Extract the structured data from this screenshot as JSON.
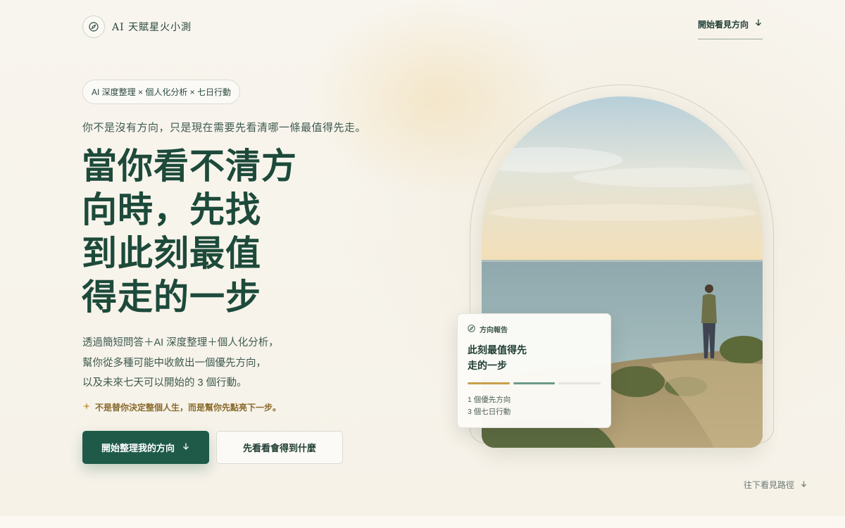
{
  "header": {
    "brand_name": "AI 天賦星火小測",
    "nav_link": "開始看見方向"
  },
  "hero": {
    "tag_pill": "AI 深度整理 × 個人化分析 × 七日行動",
    "intro": "你不是沒有方向，只是現在需要先看清哪一條最值得先走。",
    "headline": [
      "當你看不清方",
      "向時，先找",
      "到此刻最值",
      "得走的一步"
    ],
    "description": [
      "透過簡短問答＋AI 深度整理＋個人化分析，",
      "幫你從多種可能中收斂出一個優先方向，",
      "以及未來七天可以開始的 3 個行動。"
    ],
    "note": "不是替你決定整個人生，而是幫你先點亮下一步。",
    "primary_button": "開始整理我的方向",
    "secondary_button": "先看看會得到什麼"
  },
  "report_card": {
    "tag": "方向報告",
    "title": [
      "此刻最值得先",
      "走的一步"
    ],
    "items": [
      "1 個優先方向",
      "3 個七日行動"
    ]
  },
  "scroll_hint": "往下看見路徑",
  "colors": {
    "primary": "#1f5a48",
    "heading": "#1d4a3a",
    "accent_gold": "#c9a04b",
    "accent_teal": "#6d9a8a",
    "track": "#e6e4dd"
  },
  "icons": {
    "brand": "compass-icon",
    "arrow": "arrow-down-icon",
    "note": "sparkle-icon"
  }
}
